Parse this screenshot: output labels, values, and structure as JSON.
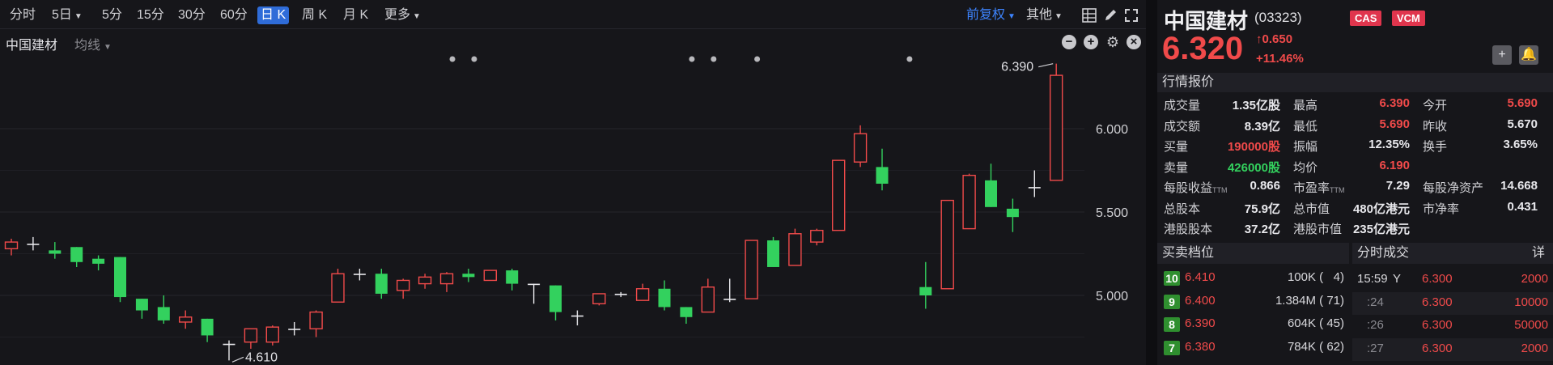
{
  "toolbar": {
    "periods": [
      {
        "label": "分时",
        "active": false,
        "caret": false
      },
      {
        "label": "5日",
        "active": false,
        "caret": true
      },
      {
        "label": "5分",
        "active": false,
        "caret": false
      },
      {
        "label": "15分",
        "active": false,
        "caret": false
      },
      {
        "label": "30分",
        "active": false,
        "caret": false
      },
      {
        "label": "60分",
        "active": false,
        "caret": false
      },
      {
        "label": "日 K",
        "active": true,
        "caret": false
      },
      {
        "label": "周 K",
        "active": false,
        "caret": false
      },
      {
        "label": "月 K",
        "active": false,
        "caret": false
      },
      {
        "label": "更多",
        "active": false,
        "caret": true
      }
    ],
    "adjust_label": "前复权",
    "other_label": "其他",
    "icons": [
      "grid-icon",
      "pen-icon",
      "fullscreen-icon"
    ]
  },
  "subbar": {
    "stock_label": "中国建材",
    "ma_label": "均线",
    "icons": [
      "minus-icon",
      "plus-icon",
      "gear-icon",
      "close-icon"
    ]
  },
  "chart_data": {
    "type": "candlestick",
    "y_ticks": [
      "6.000",
      "5.500",
      "5.000"
    ],
    "tick_values": [
      6.0,
      5.5,
      5.0
    ],
    "ylim": [
      4.41,
      6.48
    ],
    "high_annotation": "6.390",
    "high_value": 6.39,
    "low_annotation": "4.610",
    "low_value": 4.61,
    "candles": [
      {
        "o": 5.28,
        "c": 5.32,
        "h": 5.34,
        "l": 5.24
      },
      {
        "o": 5.31,
        "c": 5.31,
        "h": 5.35,
        "l": 5.27
      },
      {
        "o": 5.27,
        "c": 5.25,
        "h": 5.32,
        "l": 5.22
      },
      {
        "o": 5.29,
        "c": 5.2,
        "h": 5.29,
        "l": 5.17
      },
      {
        "o": 5.22,
        "c": 5.19,
        "h": 5.24,
        "l": 5.15
      },
      {
        "o": 5.23,
        "c": 4.99,
        "h": 5.23,
        "l": 4.96
      },
      {
        "o": 4.98,
        "c": 4.91,
        "h": 4.98,
        "l": 4.86
      },
      {
        "o": 4.93,
        "c": 4.85,
        "h": 5.0,
        "l": 4.83
      },
      {
        "o": 4.84,
        "c": 4.87,
        "h": 4.91,
        "l": 4.8
      },
      {
        "o": 4.86,
        "c": 4.76,
        "h": 4.86,
        "l": 4.72
      },
      {
        "o": 4.71,
        "c": 4.71,
        "h": 4.73,
        "l": 4.61
      },
      {
        "o": 4.72,
        "c": 4.8,
        "h": 4.8,
        "l": 4.68
      },
      {
        "o": 4.72,
        "c": 4.81,
        "h": 4.82,
        "l": 4.7
      },
      {
        "o": 4.8,
        "c": 4.8,
        "h": 4.84,
        "l": 4.76
      },
      {
        "o": 4.8,
        "c": 4.9,
        "h": 4.91,
        "l": 4.75
      },
      {
        "o": 4.96,
        "c": 5.13,
        "h": 5.16,
        "l": 4.96
      },
      {
        "o": 5.13,
        "c": 5.13,
        "h": 5.16,
        "l": 5.09
      },
      {
        "o": 5.13,
        "c": 5.01,
        "h": 5.16,
        "l": 4.98
      },
      {
        "o": 5.03,
        "c": 5.09,
        "h": 5.1,
        "l": 4.98
      },
      {
        "o": 5.07,
        "c": 5.11,
        "h": 5.13,
        "l": 5.04
      },
      {
        "o": 5.07,
        "c": 5.13,
        "h": 5.14,
        "l": 5.02
      },
      {
        "o": 5.13,
        "c": 5.11,
        "h": 5.16,
        "l": 5.08
      },
      {
        "o": 5.09,
        "c": 5.15,
        "h": 5.15,
        "l": 5.09
      },
      {
        "o": 5.15,
        "c": 5.07,
        "h": 5.16,
        "l": 5.03
      },
      {
        "o": 5.07,
        "c": 5.07,
        "h": 5.07,
        "l": 4.95
      },
      {
        "o": 5.06,
        "c": 4.9,
        "h": 5.06,
        "l": 4.85
      },
      {
        "o": 4.88,
        "c": 4.88,
        "h": 4.91,
        "l": 4.82
      },
      {
        "o": 4.95,
        "c": 5.01,
        "h": 5.01,
        "l": 4.94
      },
      {
        "o": 5.01,
        "c": 5.01,
        "h": 5.02,
        "l": 4.99
      },
      {
        "o": 4.97,
        "c": 5.04,
        "h": 5.07,
        "l": 4.97
      },
      {
        "o": 5.04,
        "c": 4.93,
        "h": 5.09,
        "l": 4.91
      },
      {
        "o": 4.93,
        "c": 4.87,
        "h": 4.93,
        "l": 4.83
      },
      {
        "o": 4.9,
        "c": 5.05,
        "h": 5.1,
        "l": 4.9
      },
      {
        "o": 4.98,
        "c": 4.98,
        "h": 5.1,
        "l": 4.96
      },
      {
        "o": 4.98,
        "c": 5.33,
        "h": 5.33,
        "l": 4.98
      },
      {
        "o": 5.33,
        "c": 5.17,
        "h": 5.35,
        "l": 5.17
      },
      {
        "o": 5.18,
        "c": 5.37,
        "h": 5.4,
        "l": 5.18
      },
      {
        "o": 5.32,
        "c": 5.39,
        "h": 5.4,
        "l": 5.3
      },
      {
        "o": 5.39,
        "c": 5.81,
        "h": 5.81,
        "l": 5.39
      },
      {
        "o": 5.8,
        "c": 5.97,
        "h": 6.02,
        "l": 5.77
      },
      {
        "o": 5.77,
        "c": 5.67,
        "h": 5.88,
        "l": 5.63
      },
      {
        "o": 5.05,
        "c": 5.0,
        "h": 5.2,
        "l": 4.92
      },
      {
        "o": 5.04,
        "c": 5.57,
        "h": 5.57,
        "l": 5.04
      },
      {
        "o": 5.4,
        "c": 5.72,
        "h": 5.73,
        "l": 5.4
      },
      {
        "o": 5.69,
        "c": 5.53,
        "h": 5.79,
        "l": 5.53
      },
      {
        "o": 5.52,
        "c": 5.47,
        "h": 5.58,
        "l": 5.38
      },
      {
        "o": 5.65,
        "c": 5.65,
        "h": 5.75,
        "l": 5.59
      },
      {
        "o": 5.69,
        "c": 6.32,
        "h": 6.39,
        "l": 5.69
      }
    ],
    "candle_slots": [
      0,
      1,
      2,
      3,
      4,
      5,
      6,
      7,
      8,
      9,
      10,
      11,
      12,
      13,
      14,
      15,
      16,
      17,
      18,
      19,
      20,
      21,
      22,
      23,
      24,
      25,
      26,
      27,
      28,
      29,
      30,
      31,
      32,
      33,
      34,
      35,
      36,
      37,
      38,
      39,
      40,
      42,
      43,
      44,
      45,
      46,
      47,
      48
    ],
    "event_markers": [
      20,
      21,
      31,
      32,
      34,
      41
    ]
  },
  "colors": {
    "up": "#f04a4a",
    "down": "#33d15e",
    "accent": "#2f6cd8",
    "background": "#16161a"
  },
  "quote": {
    "name": "中国建材",
    "code": "(03323)",
    "badges": [
      "CAS",
      "VCM"
    ],
    "price": "6.320",
    "change": "0.650",
    "change_pct": "+11.46%",
    "section_title": "行情报价",
    "rows": [
      [
        {
          "label": "成交量",
          "value": "1.35亿股",
          "color": "white"
        },
        {
          "label": "最高",
          "value": "6.390",
          "color": "red"
        },
        {
          "label": "今开",
          "value": "5.690",
          "color": "red"
        }
      ],
      [
        {
          "label": "成交额",
          "value": "8.39亿",
          "color": "white"
        },
        {
          "label": "最低",
          "value": "5.690",
          "color": "red"
        },
        {
          "label": "昨收",
          "value": "5.670",
          "color": "white"
        }
      ],
      [
        {
          "label": "买量",
          "value": "190000股",
          "color": "red"
        },
        {
          "label": "振幅",
          "value": "12.35%",
          "color": "white"
        },
        {
          "label": "换手",
          "value": "3.65%",
          "color": "white"
        }
      ],
      [
        {
          "label": "卖量",
          "value": "426000股",
          "color": "green"
        },
        {
          "label": "均价",
          "value": "6.190",
          "color": "red"
        },
        {
          "label": "",
          "value": "",
          "color": "white"
        }
      ],
      [
        {
          "label": "每股收益",
          "ttm": "TTM",
          "value": "0.866",
          "color": "white"
        },
        {
          "label": "市盈率",
          "ttm": "TTM",
          "value": "7.29",
          "color": "white"
        },
        {
          "label": "每股净资产",
          "value": "14.668",
          "color": "white"
        }
      ],
      [
        {
          "label": "总股本",
          "value": "75.9亿",
          "color": "white"
        },
        {
          "label": "总市值",
          "value": "480亿港元",
          "color": "white"
        },
        {
          "label": "市净率",
          "value": "0.431",
          "color": "white"
        }
      ],
      [
        {
          "label": "港股股本",
          "value": "37.2亿",
          "color": "white"
        },
        {
          "label": "港股市值",
          "value": "235亿港元",
          "color": "white"
        },
        {
          "label": "",
          "value": "",
          "color": "white"
        }
      ]
    ]
  },
  "order_book": {
    "title": "买卖档位",
    "rows": [
      {
        "level": "10",
        "price": "6.410",
        "volume": "100K (   4)"
      },
      {
        "level": "9",
        "price": "6.400",
        "volume": "1.384M ( 71)"
      },
      {
        "level": "8",
        "price": "6.390",
        "volume": "604K ( 45)"
      },
      {
        "level": "7",
        "price": "6.380",
        "volume": "784K ( 62)"
      }
    ]
  },
  "time_sales": {
    "title": "分时成交",
    "detail_label": "详",
    "rows": [
      {
        "time": "15:59",
        "dir": "Y",
        "price": "6.300",
        "volume": "2000"
      },
      {
        "time": ":24",
        "dir": "",
        "price": "6.300",
        "volume": "10000"
      },
      {
        "time": ":26",
        "dir": "",
        "price": "6.300",
        "volume": "50000"
      },
      {
        "time": ":27",
        "dir": "",
        "price": "6.300",
        "volume": "2000"
      }
    ]
  }
}
